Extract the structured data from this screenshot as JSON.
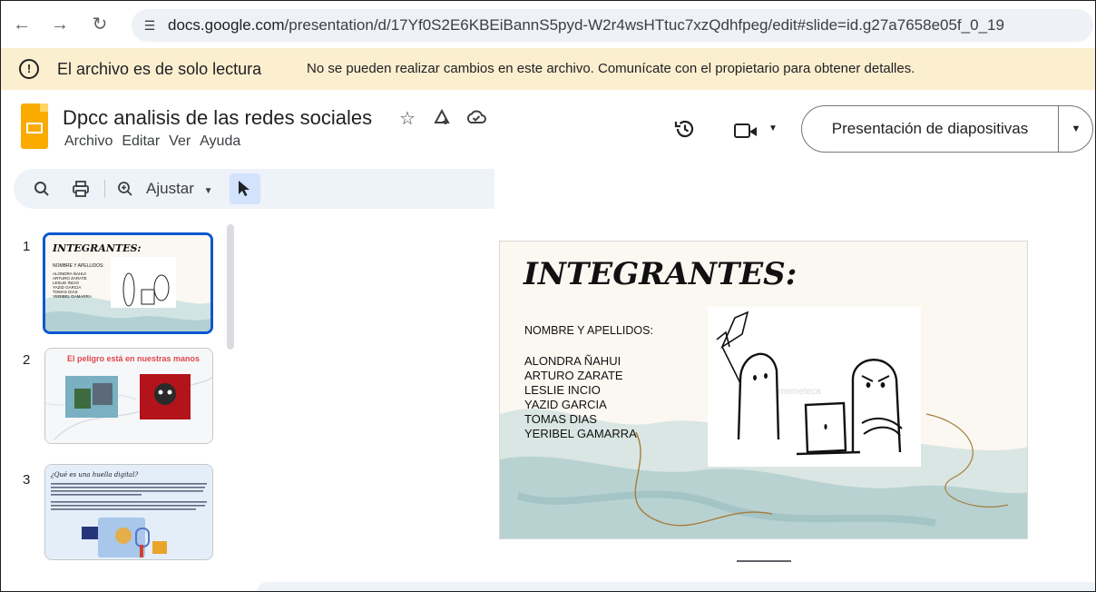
{
  "browser": {
    "url_host": "docs.google.com",
    "url_path": "/presentation/d/17Yf0S2E6KBEiBannS5pyd-W2r4wsHTtuc7xzQdhfpeg/edit#slide=id.g27a7658e05f_0_19",
    "back_icon": "arrow-left-icon",
    "forward_icon": "arrow-right-icon",
    "reload_icon": "reload-icon"
  },
  "banner": {
    "title": "El archivo es de solo lectura",
    "message": "No se pueden realizar cambios en este archivo. Comunícate con el propietario para obtener detalles."
  },
  "doc": {
    "title": "Dpcc  analisis de las redes sociales",
    "menu": [
      "Archivo",
      "Editar",
      "Ver",
      "Ayuda"
    ]
  },
  "header": {
    "present_label": "Presentación de diapositivas"
  },
  "toolbar": {
    "zoom_label": "Ajustar"
  },
  "filmstrip": {
    "slides": [
      {
        "number": "1",
        "title": "INTEGRANTES:",
        "subtitle": "NOMBRE Y APELLIDOS:",
        "names": [
          "ALONDRA ÑAHUI",
          "ARTURO ZARATE",
          "LESLIE INCIO",
          "YAZID GARCIA",
          "TOMAS DIAS",
          "YERIBEL GAMARRA"
        ]
      },
      {
        "number": "2",
        "title": "El peligro está en nuestras manos"
      },
      {
        "number": "3",
        "title": "¿Qué es una huella digital?"
      }
    ]
  },
  "slide": {
    "title": "INTEGRANTES:",
    "subtitle": "NOMBRE Y APELLIDOS:",
    "members": [
      "ALONDRA ÑAHUI",
      "ARTURO ZARATE",
      "LESLIE INCIO",
      "YAZID GARCIA",
      "TOMAS DIAS",
      "YERIBEL GAMARRA"
    ]
  },
  "colors": {
    "banner_bg": "#fcefcf",
    "accent": "#0b57d0",
    "slides_logo": "#f9ab00"
  }
}
